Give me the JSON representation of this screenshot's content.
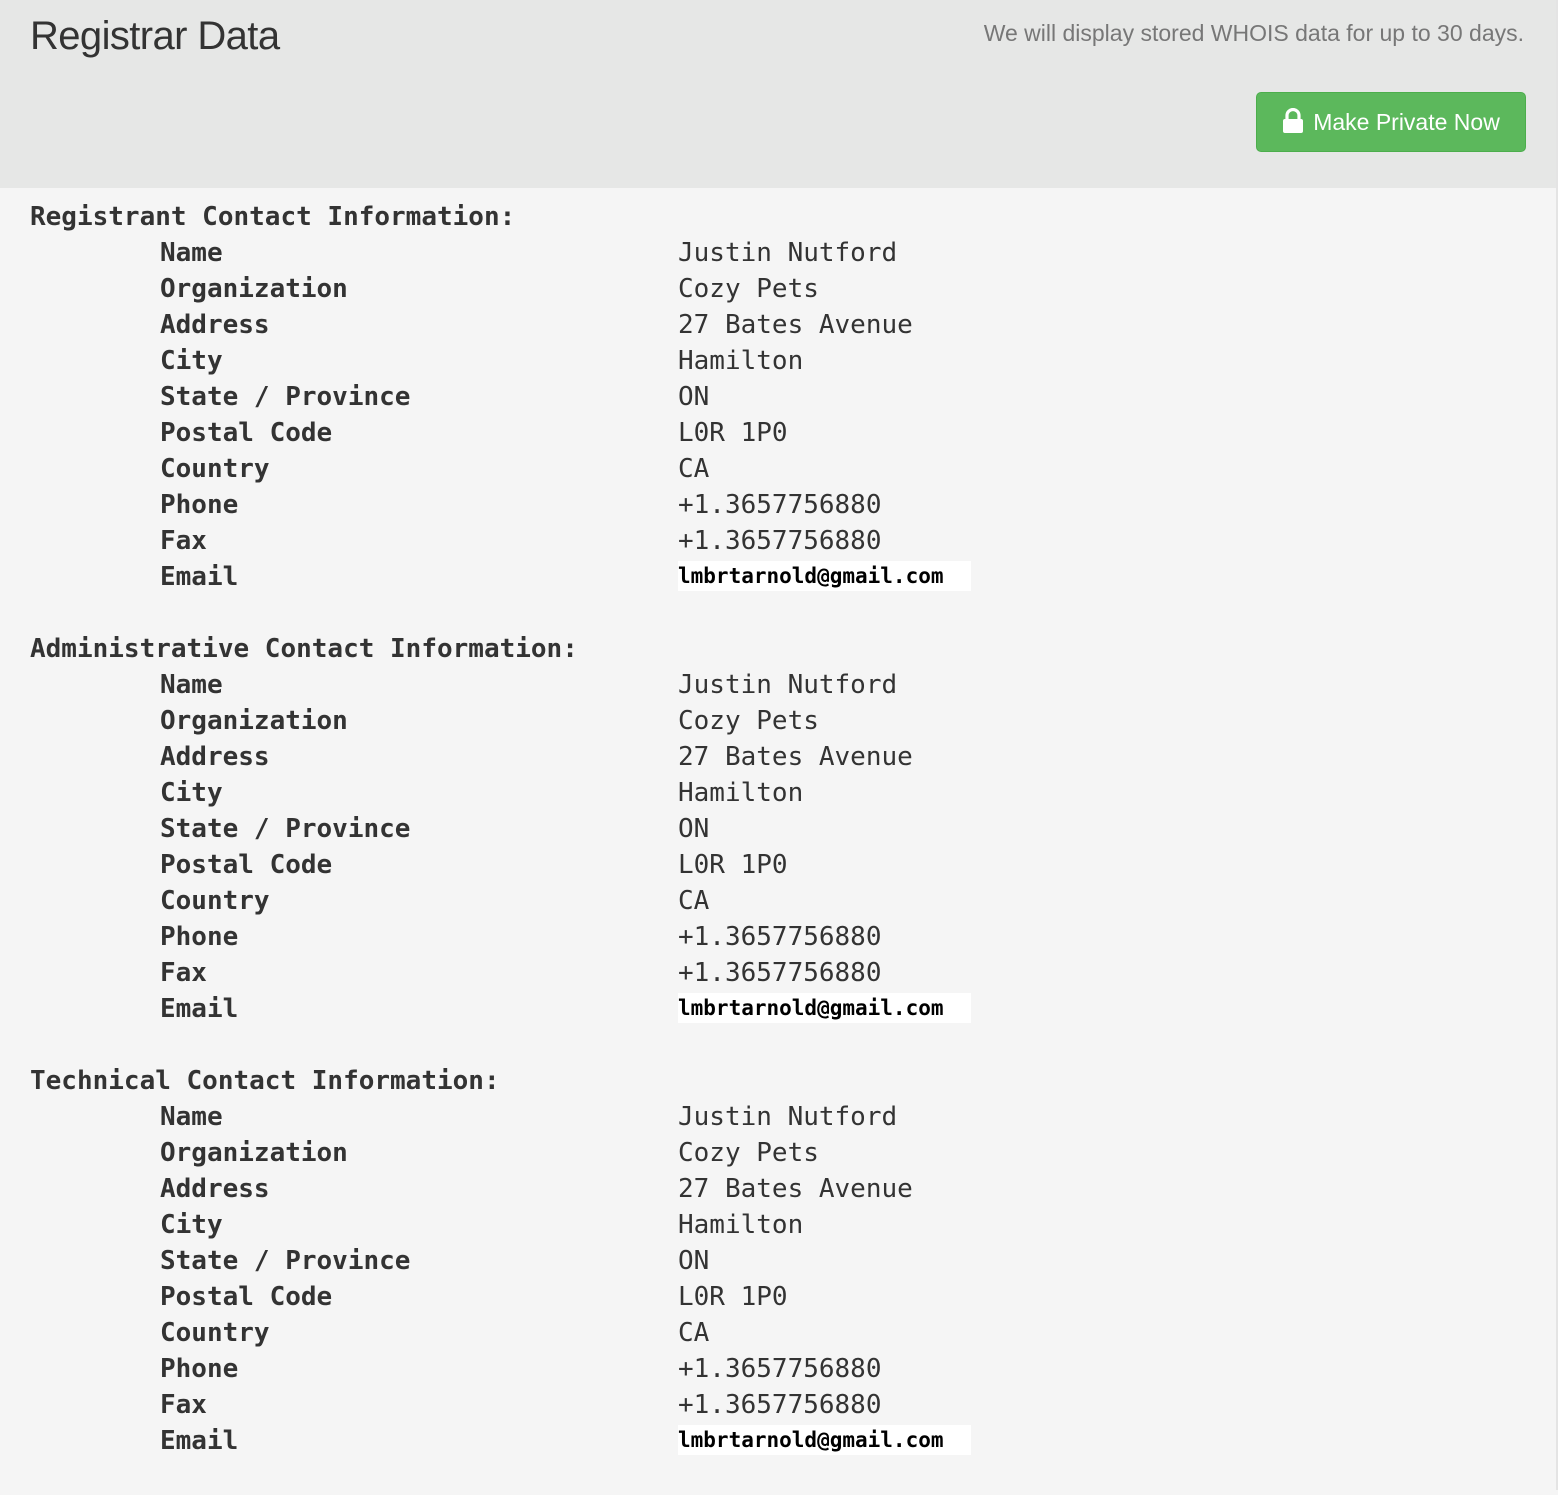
{
  "header": {
    "title": "Registrar Data",
    "note": "We will display stored WHOIS data for up to 30 days.",
    "button_label": "Make Private Now",
    "button_icon": "lock-icon"
  },
  "colors": {
    "header_bg": "#e6e7e6",
    "page_bg": "#f5f5f5",
    "button_bg": "#5cb85c",
    "button_border": "#4cae4c"
  },
  "sections": [
    {
      "title": "Registrant Contact Information:",
      "fields": [
        {
          "label": "Name",
          "value": "Justin Nutford"
        },
        {
          "label": "Organization",
          "value": "Cozy Pets"
        },
        {
          "label": "Address",
          "value": "27 Bates Avenue"
        },
        {
          "label": "City",
          "value": "Hamilton"
        },
        {
          "label": "State / Province",
          "value": "ON"
        },
        {
          "label": "Postal Code",
          "value": "L0R 1P0"
        },
        {
          "label": "Country",
          "value": "CA"
        },
        {
          "label": "Phone",
          "value": "+1.3657756880"
        },
        {
          "label": "Fax",
          "value": "+1.3657756880"
        },
        {
          "label": "Email",
          "value": "lmbrtarnold@gmail.com"
        }
      ]
    },
    {
      "title": "Administrative Contact Information:",
      "fields": [
        {
          "label": "Name",
          "value": "Justin Nutford"
        },
        {
          "label": "Organization",
          "value": "Cozy Pets"
        },
        {
          "label": "Address",
          "value": "27 Bates Avenue"
        },
        {
          "label": "City",
          "value": "Hamilton"
        },
        {
          "label": "State / Province",
          "value": "ON"
        },
        {
          "label": "Postal Code",
          "value": "L0R 1P0"
        },
        {
          "label": "Country",
          "value": "CA"
        },
        {
          "label": "Phone",
          "value": "+1.3657756880"
        },
        {
          "label": "Fax",
          "value": "+1.3657756880"
        },
        {
          "label": "Email",
          "value": "lmbrtarnold@gmail.com"
        }
      ]
    },
    {
      "title": "Technical Contact Information:",
      "fields": [
        {
          "label": "Name",
          "value": "Justin Nutford"
        },
        {
          "label": "Organization",
          "value": "Cozy Pets"
        },
        {
          "label": "Address",
          "value": "27 Bates Avenue"
        },
        {
          "label": "City",
          "value": "Hamilton"
        },
        {
          "label": "State / Province",
          "value": "ON"
        },
        {
          "label": "Postal Code",
          "value": "L0R 1P0"
        },
        {
          "label": "Country",
          "value": "CA"
        },
        {
          "label": "Phone",
          "value": "+1.3657756880"
        },
        {
          "label": "Fax",
          "value": "+1.3657756880"
        },
        {
          "label": "Email",
          "value": "lmbrtarnold@gmail.com"
        }
      ]
    }
  ]
}
